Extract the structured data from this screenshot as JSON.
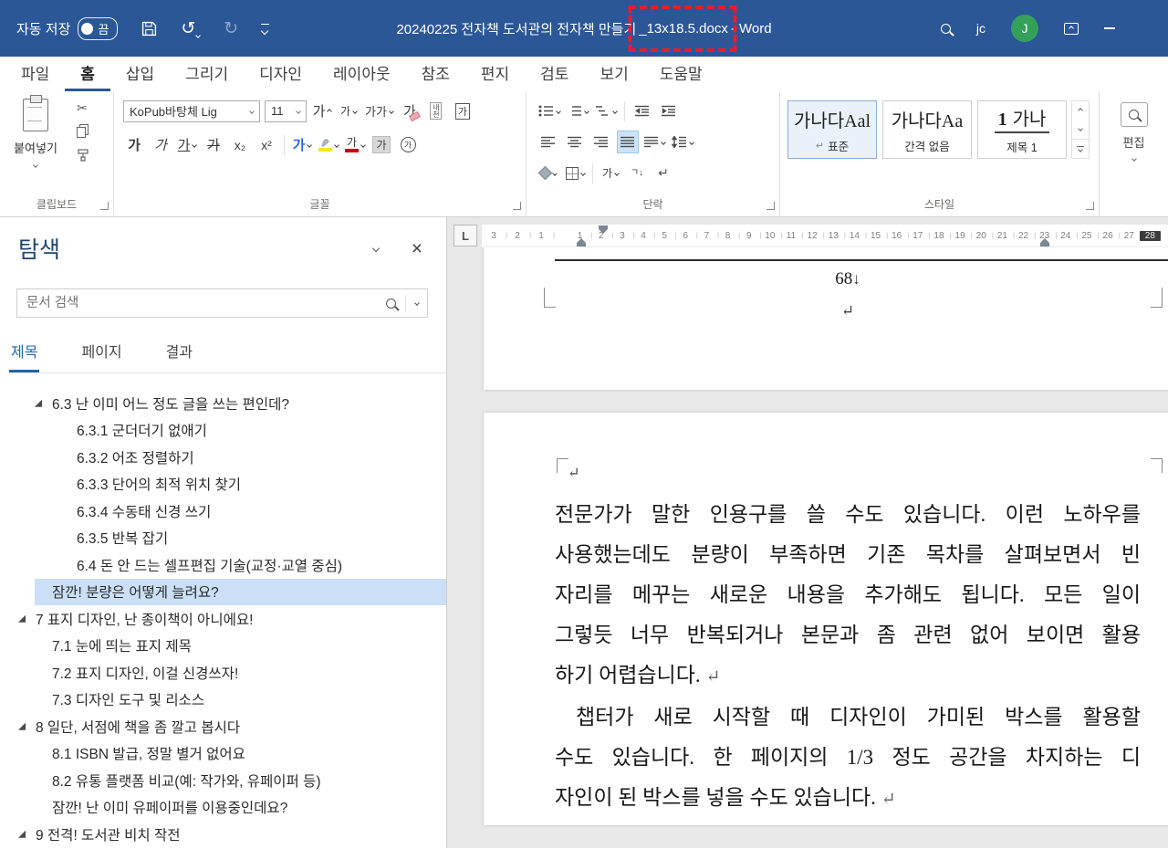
{
  "titlebar": {
    "autosave_label": "자동 저장",
    "autosave_state": "끔",
    "doc_title_prefix": "20240225 전자책 도서관의 전자책 만들기",
    "doc_title_highlight": "_13x18.5.docx",
    "doc_title_suffix": " - Word",
    "user_short": "jc",
    "avatar_initial": "J"
  },
  "tabs": {
    "items": [
      {
        "label": "파일"
      },
      {
        "label": "홈",
        "active": true
      },
      {
        "label": "삽입"
      },
      {
        "label": "그리기"
      },
      {
        "label": "디자인"
      },
      {
        "label": "레이아웃"
      },
      {
        "label": "참조"
      },
      {
        "label": "편지"
      },
      {
        "label": "검토"
      },
      {
        "label": "보기"
      },
      {
        "label": "도움말"
      }
    ]
  },
  "ribbon": {
    "clipboard": {
      "paste_label": "붙여넣기",
      "group_label": "클립보드"
    },
    "font": {
      "font_name": "KoPub바탕체 Lig",
      "font_size": "11",
      "group_label": "글꼴",
      "glyphs": {
        "ga": "가",
        "gaga": "가가",
        "sub": "x₂",
        "sup": "x²",
        "phonetic_top": "내",
        "phonetic_bottom": "천"
      }
    },
    "paragraph": {
      "group_label": "단락",
      "glyphs": {
        "ga": "가",
        "sort": "ㄱ",
        "sort_arrow": "↓",
        "marks": "↵"
      }
    },
    "styles": {
      "group_label": "스타일",
      "items": [
        {
          "preview": "가나다Aal",
          "name": "표준",
          "marker": "↵",
          "selected": true
        },
        {
          "preview": "가나다Aa",
          "name": "간격 없음"
        },
        {
          "preview": "가나",
          "prefix": "1",
          "name": "제목 1",
          "heading": true
        }
      ]
    },
    "editing": {
      "label": "편집"
    }
  },
  "navigation": {
    "title": "탐색",
    "search_placeholder": "문서 검색",
    "tabs": [
      {
        "label": "제목",
        "active": true
      },
      {
        "label": "페이지"
      },
      {
        "label": "결과"
      }
    ],
    "items": [
      {
        "label": "6.3 난 이미 어느 정도 글을 쓰는 편인데?",
        "level": 1,
        "expander": true
      },
      {
        "label": "6.3.1 군더더기 없애기",
        "level": 2
      },
      {
        "label": "6.3.2 어조 정렬하기",
        "level": 2
      },
      {
        "label": "6.3.3 단어의 최적 위치 찾기",
        "level": 2
      },
      {
        "label": "6.3.4 수동태 신경 쓰기",
        "level": 2
      },
      {
        "label": "6.3.5 반복 잡기",
        "level": 2
      },
      {
        "label": "6.4 돈 안 드는 셀프편집 기술(교정·교열 중심)",
        "level": 2
      },
      {
        "label": "잠깐! 분량은 어떻게 늘려요?",
        "level": 1,
        "selected": true
      },
      {
        "label": "7 표지 디자인, 난 종이책이 아니에요!",
        "level": 0,
        "expander": true
      },
      {
        "label": "7.1 눈에 띄는 표지 제목",
        "level": 1
      },
      {
        "label": "7.2 표지 디자인, 이걸 신경쓰자!",
        "level": 1
      },
      {
        "label": "7.3 디자인 도구 및 리소스",
        "level": 1
      },
      {
        "label": "8 일단, 서점에 책을 좀 깔고 봅시다",
        "level": 0,
        "expander": true
      },
      {
        "label": "8.1 ISBN 발급, 정말 별거 없어요",
        "level": 1
      },
      {
        "label": "8.2 유통 플랫폼 비교(예: 작가와, 유페이퍼 등)",
        "level": 1
      },
      {
        "label": "잠깐! 난 이미 유페이퍼를 이용중인데요?",
        "level": 1
      },
      {
        "label": "9 전격! 도서관 비치 작전",
        "level": 0,
        "expander": true
      }
    ]
  },
  "ruler": {
    "tab_selector": "L",
    "left_numbers": [
      "3",
      "2",
      "1"
    ],
    "numbers": [
      "1",
      "2",
      "3",
      "4",
      "5",
      "6",
      "7",
      "8",
      "9",
      "10",
      "11",
      "12",
      "13",
      "14",
      "15",
      "16",
      "17",
      "18",
      "19",
      "20",
      "21",
      "22",
      "23",
      "24",
      "25",
      "26",
      "27",
      "28"
    ]
  },
  "document": {
    "marks": {
      "pilcrow": "↵",
      "linebreak": "↓"
    },
    "page1": {
      "page_number": "68"
    },
    "page2": {
      "p1_lines": [
        "전문가가 말한 인용구를 쓸 수도 있습니다. 이런 노하우를",
        "사용했는데도 분량이 부족하면 기존 목차를 살펴보면서 빈",
        "자리를 메꾸는 새로운 내용을 추가해도 됩니다. 모든 일이",
        "그렇듯 너무 반복되거나 본문과 좀 관련 없어 보이면 활용"
      ],
      "p1_last": "하기 어렵습니다.",
      "p2_lines": [
        "챕터가 새로 시작할 때 디자인이 가미된 박스를 활용할",
        "수도 있습니다. 한 페이지의 1/3 정도 공간을 차지하는 디"
      ],
      "p2_last": "자인이 된 박스를 넣을 수도 있습니다."
    }
  }
}
